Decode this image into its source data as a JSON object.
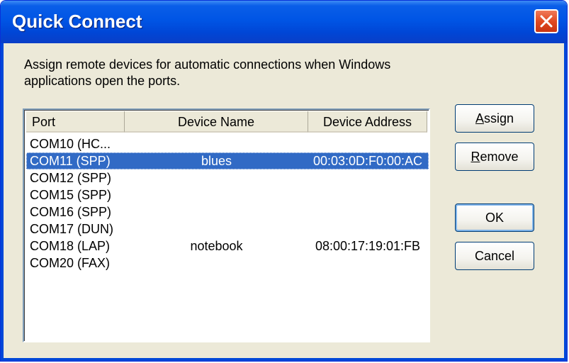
{
  "window": {
    "title": "Quick Connect"
  },
  "description": "Assign remote devices for automatic connections when Windows applications open the ports.",
  "list": {
    "columns": [
      "Port",
      "Device Name",
      "Device Address"
    ],
    "rows": [
      {
        "port": "COM10 (HC...",
        "name": "",
        "address": ""
      },
      {
        "port": "COM11 (SPP)",
        "name": "blues",
        "address": "00:03:0D:F0:00:AC",
        "selected": true
      },
      {
        "port": "COM12 (SPP)",
        "name": "",
        "address": ""
      },
      {
        "port": "COM15 (SPP)",
        "name": "",
        "address": ""
      },
      {
        "port": "COM16 (SPP)",
        "name": "",
        "address": ""
      },
      {
        "port": "COM17 (DUN)",
        "name": "",
        "address": ""
      },
      {
        "port": "COM18 (LAP)",
        "name": "notebook",
        "address": "08:00:17:19:01:FB"
      },
      {
        "port": "COM20 (FAX)",
        "name": "",
        "address": ""
      }
    ]
  },
  "buttons": {
    "assign": {
      "mnemonic": "A",
      "rest": "ssign"
    },
    "remove": {
      "mnemonic": "R",
      "rest": "emove"
    },
    "ok": "OK",
    "cancel": "Cancel"
  },
  "colors": {
    "titlebar": "#0055e5",
    "selection": "#316ac5",
    "close": "#e14a22",
    "face": "#ece9d8"
  }
}
